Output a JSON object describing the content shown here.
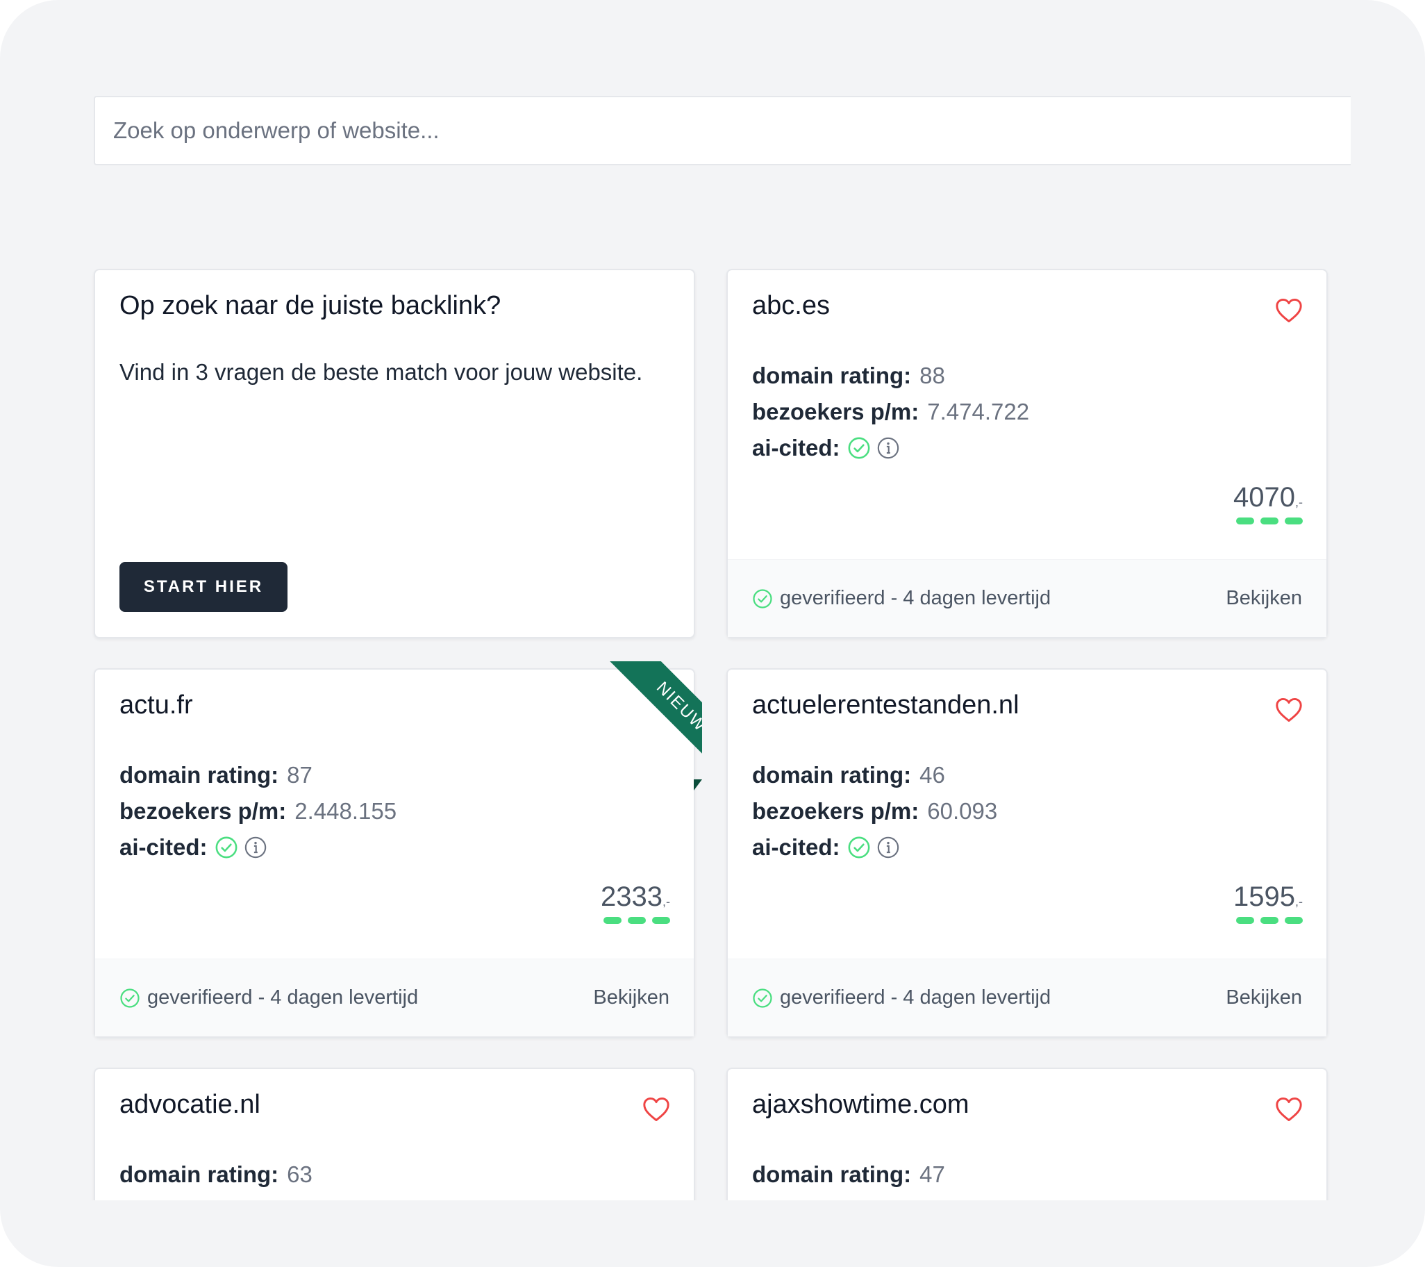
{
  "search": {
    "placeholder": "Zoek op onderwerp of website..."
  },
  "promo": {
    "title": "Op zoek naar de juiste backlink?",
    "text": "Vind in 3 vragen de beste match voor jouw website.",
    "button": "START HIER"
  },
  "labels": {
    "domain_rating": "domain rating:",
    "visitors": "bezoekers p/m:",
    "ai_cited": "ai-cited:",
    "price_suffix": ",-",
    "verified": "geverifieerd - 4 dagen levertijd",
    "view": "Bekijken",
    "new_ribbon": "NIEUW"
  },
  "colors": {
    "accent_green": "#4ade80",
    "ribbon_green": "#137358",
    "heart_red": "#ef4444",
    "dark_button": "#1f2937"
  },
  "listings": [
    {
      "domain": "abc.es",
      "domain_rating": "88",
      "visitors": "7.474.722",
      "ai_cited": true,
      "price": "4070",
      "price_level": 3,
      "favorite_icon": "heart-outline-icon"
    },
    {
      "domain": "actu.fr",
      "domain_rating": "87",
      "visitors": "2.448.155",
      "ai_cited": true,
      "price": "2333",
      "price_level": 3,
      "badge": "NIEUW"
    },
    {
      "domain": "actuelerentestanden.nl",
      "domain_rating": "46",
      "visitors": "60.093",
      "ai_cited": true,
      "price": "1595",
      "price_level": 3,
      "favorite_icon": "heart-outline-icon"
    },
    {
      "domain": "advocatie.nl",
      "domain_rating": "63",
      "favorite_icon": "heart-outline-icon"
    },
    {
      "domain": "ajaxshowtime.com",
      "domain_rating": "47",
      "favorite_icon": "heart-outline-icon"
    }
  ]
}
